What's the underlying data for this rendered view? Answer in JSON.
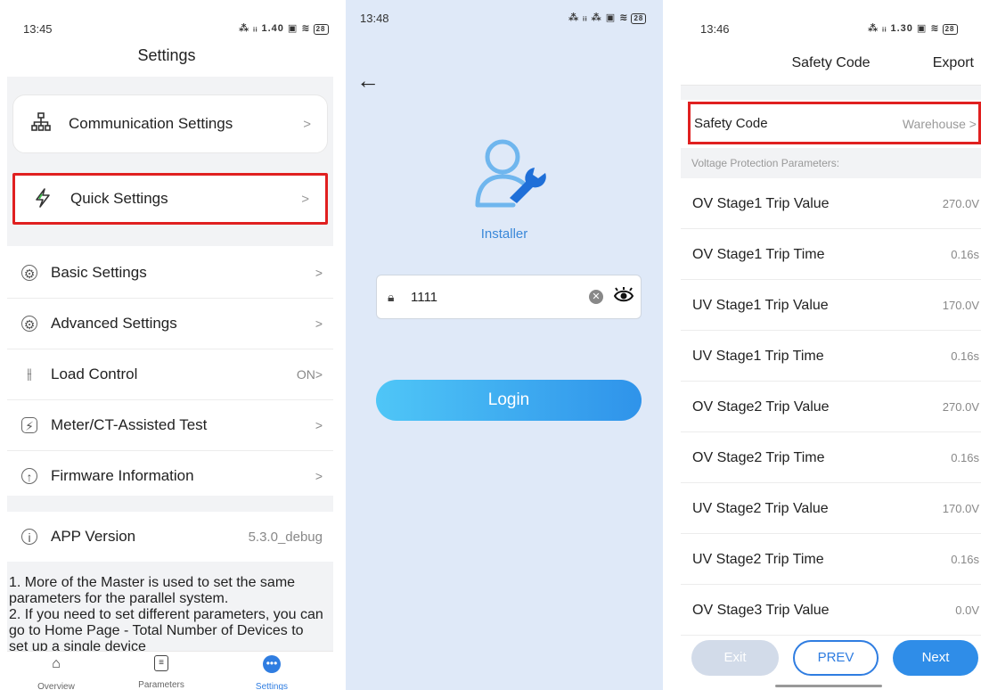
{
  "settings_screen": {
    "status": {
      "time": "13:45",
      "right": "⁂ ᵢᵢ 1.40 ▣ ≋"
    },
    "title": "Settings",
    "cards": [
      {
        "label": "Communication Settings",
        "icon": "network-icon"
      },
      {
        "label": "Quick Settings",
        "icon": "lightning-icon"
      }
    ],
    "rows": [
      {
        "label": "Basic Settings",
        "value": "",
        "icon": "gear-icon"
      },
      {
        "label": "Advanced Settings",
        "value": "",
        "icon": "advanced-gear-icon"
      },
      {
        "label": "Load Control",
        "value": "ON",
        "icon": "sliders-icon"
      },
      {
        "label": "Meter/CT-Assisted Test",
        "value": "",
        "icon": "meter-icon"
      },
      {
        "label": "Firmware Information",
        "value": "",
        "icon": "upgrade-icon"
      },
      {
        "label": "APP Version",
        "value": "5.3.0_debug",
        "icon": "info-icon"
      }
    ],
    "note": "1. More of the Master is used to set the same parameters for the parallel system.\n2. If you need to set different parameters, you can go to Home Page - Total Number of Devices to set up a single device",
    "tabs": [
      {
        "label": "Overview",
        "icon": "home-icon"
      },
      {
        "label": "Parameters",
        "icon": "document-icon"
      },
      {
        "label": "Settings",
        "icon": "more-icon"
      }
    ],
    "battery": "28"
  },
  "login_screen": {
    "status": {
      "time": "13:48",
      "right": "⁂ ᵢᵢ ⁂ ▣ ≋"
    },
    "role": "Installer",
    "password": "1111",
    "login_label": "Login",
    "battery": "28"
  },
  "safety_screen": {
    "status": {
      "time": "13:46",
      "right": "⁂ ᵢᵢ 1.30 ▣ ≋"
    },
    "title": "Safety Code",
    "export_label": "Export",
    "safety_code_label": "Safety Code",
    "safety_code_value": "Warehouse",
    "section_label": "Voltage Protection Parameters:",
    "params": [
      {
        "label": "OV Stage1 Trip Value",
        "value": "270.0V"
      },
      {
        "label": "OV Stage1 Trip Time",
        "value": "0.16s"
      },
      {
        "label": "UV Stage1 Trip Value",
        "value": "170.0V"
      },
      {
        "label": "UV Stage1 Trip Time",
        "value": "0.16s"
      },
      {
        "label": "OV Stage2 Trip Value",
        "value": "270.0V"
      },
      {
        "label": "OV Stage2 Trip Time",
        "value": "0.16s"
      },
      {
        "label": "UV Stage2 Trip Value",
        "value": "170.0V"
      },
      {
        "label": "UV Stage2 Trip Time",
        "value": "0.16s"
      },
      {
        "label": "OV Stage3 Trip Value",
        "value": "0.0V"
      }
    ],
    "exit_label": "Exit",
    "prev_label": "PREV",
    "next_label": "Next",
    "battery": "28"
  },
  "colors": {
    "accent": "#2f7de1",
    "highlight": "#e02020",
    "gray_bg": "#f2f3f5",
    "login_bg": "#dfe9f8"
  }
}
